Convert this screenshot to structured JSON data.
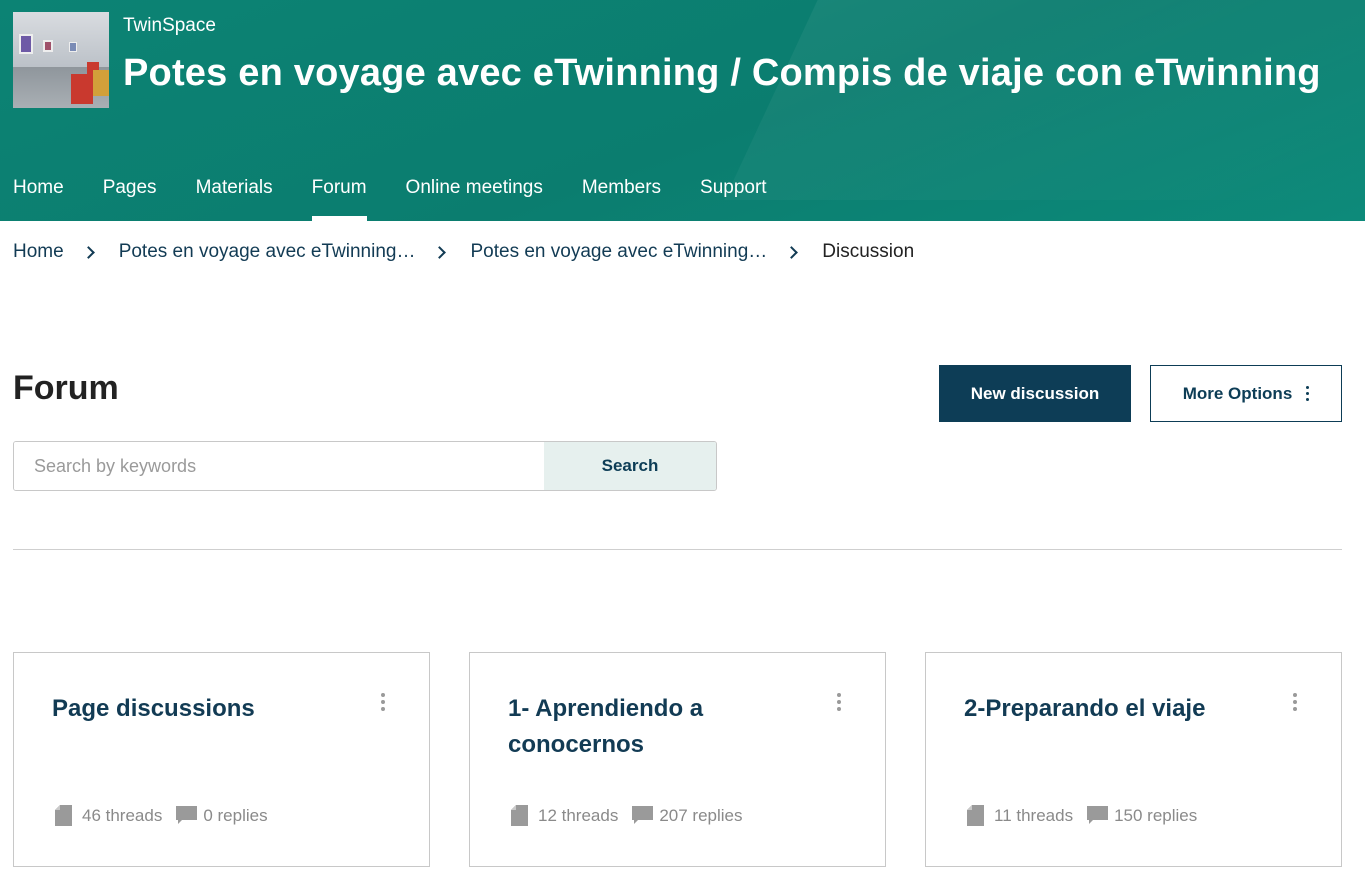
{
  "header": {
    "brand": "TwinSpace",
    "title": "Potes en voyage avec eTwinning / Compis de viaje con eTwinning",
    "nav": [
      {
        "label": "Home"
      },
      {
        "label": "Pages"
      },
      {
        "label": "Materials"
      },
      {
        "label": "Forum",
        "active": true
      },
      {
        "label": "Online meetings"
      },
      {
        "label": "Members"
      },
      {
        "label": "Support"
      }
    ],
    "accent_color": "#0b7d6f"
  },
  "breadcrumb": [
    "Home",
    "Potes en voyage avec eTwinning…",
    "Potes en voyage avec eTwinning…",
    "Discussion"
  ],
  "main": {
    "title": "Forum",
    "new_discussion_label": "New discussion",
    "more_options_label": "More Options",
    "search": {
      "placeholder": "Search by keywords",
      "value": "",
      "button_label": "Search"
    },
    "button_color": "#0d3d56"
  },
  "forums": [
    {
      "title": "Page discussions",
      "threads": "46 threads",
      "replies": "0 replies"
    },
    {
      "title": "1- Aprendiendo a conocernos",
      "threads": "12 threads",
      "replies": "207 replies"
    },
    {
      "title": "2-Preparando el viaje",
      "threads": "11 threads",
      "replies": "150 replies"
    }
  ]
}
